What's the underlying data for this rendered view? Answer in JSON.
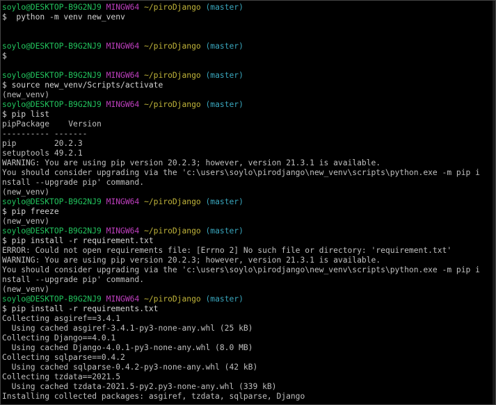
{
  "prompt": {
    "user": "soylo@DESKTOP-B9G2NJ9",
    "system": "MINGW64",
    "path": "~/piroDjango",
    "branch": "(master)",
    "symbol": "$"
  },
  "lines": [
    {
      "type": "prompt"
    },
    {
      "type": "cmd",
      "text": "$  python -m venv new_venv"
    },
    {
      "type": "blank"
    },
    {
      "type": "blank"
    },
    {
      "type": "prompt"
    },
    {
      "type": "cmd",
      "text": "$"
    },
    {
      "type": "blank"
    },
    {
      "type": "prompt"
    },
    {
      "type": "cmd",
      "text": "$ source new_venv/Scripts/activate"
    },
    {
      "type": "out",
      "text": "(new_venv)"
    },
    {
      "type": "prompt"
    },
    {
      "type": "cmd",
      "text": "$ pip list"
    },
    {
      "type": "out",
      "text": "pipPackage    Version"
    },
    {
      "type": "out",
      "text": "---------- -------"
    },
    {
      "type": "out",
      "text": "pip        20.2.3"
    },
    {
      "type": "out",
      "text": "setuptools 49.2.1"
    },
    {
      "type": "out",
      "text": "WARNING: You are using pip version 20.2.3; however, version 21.3.1 is available."
    },
    {
      "type": "out",
      "text": "You should consider upgrading via the 'c:\\users\\soylo\\pirodjango\\new_venv\\scripts\\python.exe -m pip i"
    },
    {
      "type": "out",
      "text": "nstall --upgrade pip' command."
    },
    {
      "type": "out",
      "text": "(new_venv)"
    },
    {
      "type": "prompt"
    },
    {
      "type": "cmd",
      "text": "$ pip freeze"
    },
    {
      "type": "out",
      "text": "(new_venv)"
    },
    {
      "type": "prompt"
    },
    {
      "type": "cmd",
      "text": "$ pip install -r requirement.txt"
    },
    {
      "type": "out",
      "text": "ERROR: Could not open requirements file: [Errno 2] No such file or directory: 'requirement.txt'"
    },
    {
      "type": "out",
      "text": "WARNING: You are using pip version 20.2.3; however, version 21.3.1 is available."
    },
    {
      "type": "out",
      "text": "You should consider upgrading via the 'c:\\users\\soylo\\pirodjango\\new_venv\\scripts\\python.exe -m pip i"
    },
    {
      "type": "out",
      "text": "nstall --upgrade pip' command."
    },
    {
      "type": "out",
      "text": "(new_venv)"
    },
    {
      "type": "prompt"
    },
    {
      "type": "cmd",
      "text": "$ pip install -r requirements.txt"
    },
    {
      "type": "out",
      "text": "Collecting asgiref==3.4.1"
    },
    {
      "type": "out",
      "text": "  Using cached asgiref-3.4.1-py3-none-any.whl (25 kB)"
    },
    {
      "type": "out",
      "text": "Collecting Django==4.0.1"
    },
    {
      "type": "out",
      "text": "  Using cached Django-4.0.1-py3-none-any.whl (8.0 MB)"
    },
    {
      "type": "out",
      "text": "Collecting sqlparse==0.4.2"
    },
    {
      "type": "out",
      "text": "  Using cached sqlparse-0.4.2-py3-none-any.whl (42 kB)"
    },
    {
      "type": "out",
      "text": "Collecting tzdata==2021.5"
    },
    {
      "type": "out",
      "text": "  Using cached tzdata-2021.5-py2.py3-none-any.whl (339 kB)"
    },
    {
      "type": "out",
      "text": "Installing collected packages: asgiref, tzdata, sqlparse, Django"
    }
  ],
  "colors": {
    "background": "#000000",
    "text": "#c0c0c0",
    "user": "#22c55e",
    "system": "#bf3fbf",
    "path": "#c0b43a",
    "branch": "#3aa8bf"
  }
}
